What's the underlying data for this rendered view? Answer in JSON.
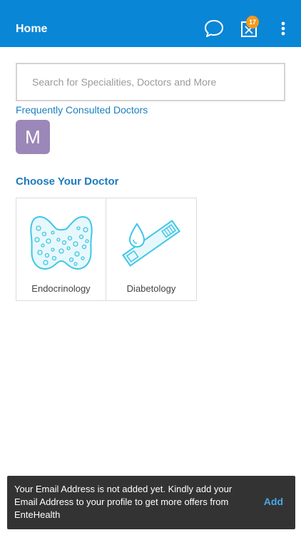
{
  "appbar": {
    "title": "Home",
    "notification_count": "17",
    "icons": [
      "chat-bubble-icon",
      "message-notification-icon",
      "more-vert-icon"
    ]
  },
  "search": {
    "placeholder": "Search for Specialities, Doctors and More"
  },
  "frequent": {
    "title": "Frequently Consulted Doctors",
    "doctors": [
      {
        "initial": "M",
        "color": "#9b87b8"
      }
    ]
  },
  "choose": {
    "title": "Choose Your Doctor",
    "specialities": [
      {
        "label": "Endocrinology",
        "icon": "thyroid-icon"
      },
      {
        "label": "Diabetology",
        "icon": "blood-test-strip-icon"
      }
    ]
  },
  "snackbar": {
    "message": "Your Email Address is not added yet. Kindly add your Email Address to your profile to get more offers from EnteHealth",
    "action": "Add"
  },
  "colors": {
    "primary": "#0a86d6",
    "accent_link": "#1a7fc1",
    "badge": "#f39a1e",
    "snackbar_bg": "#333333",
    "snackbar_action": "#4aa8e8",
    "illustration": "#3ec7e6"
  }
}
